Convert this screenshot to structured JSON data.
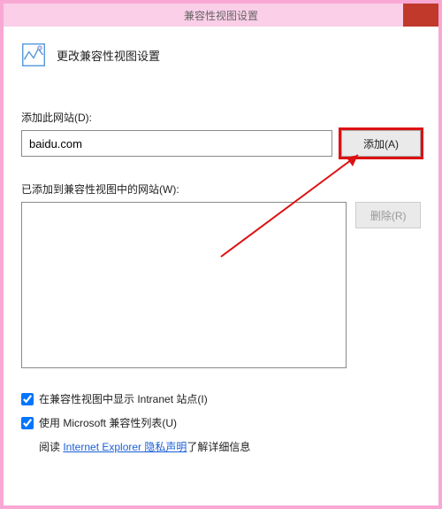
{
  "window": {
    "title": "兼容性视图设置"
  },
  "header": {
    "title": "更改兼容性视图设置"
  },
  "add_section": {
    "label": "添加此网站(D):",
    "value": "baidu.com",
    "add_button": "添加(A)"
  },
  "list_section": {
    "label": "已添加到兼容性视图中的网站(W):",
    "remove_button": "删除(R)"
  },
  "checkboxes": {
    "intranet": "在兼容性视图中显示 Intranet 站点(I)",
    "microsoft": "使用 Microsoft 兼容性列表(U)"
  },
  "footer": {
    "prefix": "阅读 ",
    "link": "Internet Explorer 隐私声明",
    "suffix": "了解详细信息"
  }
}
